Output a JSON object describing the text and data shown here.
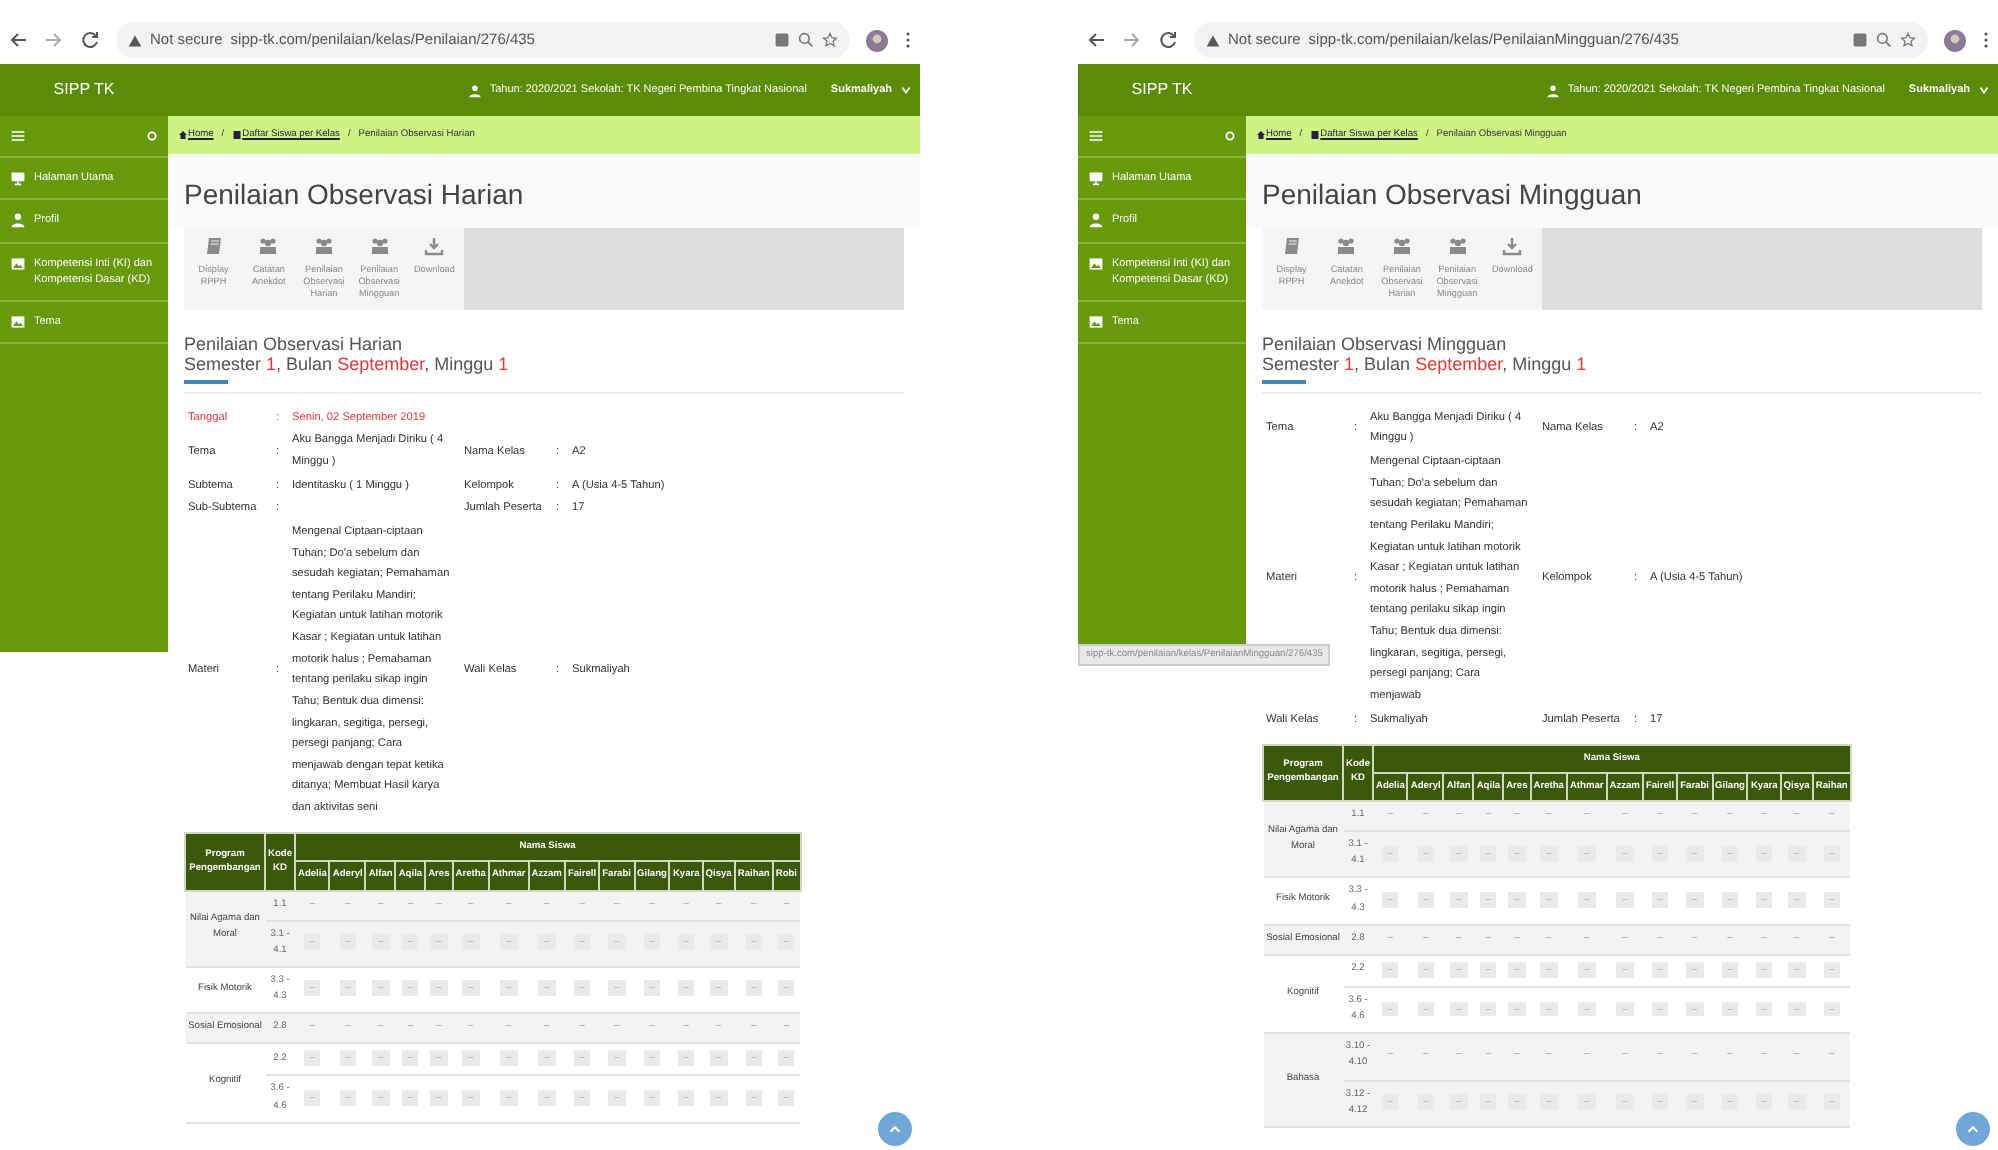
{
  "panes": [
    {
      "browser": {
        "security": "Not secure",
        "url": "sipp-tk.com/penilaian/kelas/Penilaian/276/435"
      },
      "header": {
        "brand": "SIPP TK",
        "info": "Tahun: 2020/2021 Sekolah: TK Negeri Pembina Tingkat Nasional",
        "user": "Sukmaliyah"
      },
      "sidebar": {
        "items": [
          {
            "label": "Halaman Utama"
          },
          {
            "label": "Profil"
          },
          {
            "label": "Kompetensi Inti (KI) dan Kompetensi Dasar (KD)"
          },
          {
            "label": "Tema"
          }
        ]
      },
      "breadcrumb": {
        "separator": "/",
        "items": [
          {
            "label": "Home",
            "link": true
          },
          {
            "label": "Daftar Siswa per Kelas",
            "link": true
          },
          {
            "label": "Penilaian Observasi Harian",
            "link": false
          }
        ]
      },
      "page_title": "Penilaian Observasi Harian",
      "toolbar": [
        "Display RPPH",
        "Catatan Anekdot",
        "Penilaian Observasi Harian",
        "Penilaian Observasi Mingguan",
        "Download"
      ],
      "section_title": "Penilaian Observasi Harian",
      "subtitle": [
        {
          "text": "Semester ",
          "highlight": false
        },
        {
          "text": "1",
          "highlight": true
        },
        {
          "text": ", Bulan ",
          "highlight": false
        },
        {
          "text": "September",
          "highlight": true
        },
        {
          "text": ", Minggu ",
          "highlight": false
        },
        {
          "text": "1",
          "highlight": true
        }
      ],
      "info_rows": [
        {
          "left": {
            "label": "Tanggal",
            "colon": ":",
            "value": "Senin, 02 September 2019",
            "highlight": true
          }
        },
        {
          "left": {
            "label": "Tema",
            "colon": ":",
            "value": "Aku Bangga Menjadi Diriku ( 4 Minggu )",
            "highlight": false
          },
          "right": {
            "label": "Nama Kelas",
            "colon": ":",
            "value": "A2"
          }
        },
        {
          "left": {
            "label": "Subtema",
            "colon": ":",
            "value": "Identitasku ( 1 Minggu )",
            "highlight": false
          },
          "right": {
            "label": "Kelompok",
            "colon": ":",
            "value": "A (Usia 4-5 Tahun)"
          }
        },
        {
          "left": {
            "label": "Sub-Subtema",
            "colon": ":",
            "highlight": false
          },
          "right": {
            "label": "Jumlah Peserta",
            "colon": ":",
            "value": "17"
          }
        },
        {
          "left": {
            "label": "Materi",
            "colon": ":",
            "value": "Mengenal Ciptaan-ciptaan Tuhan; Do'a sebelum dan sesudah kegiatan; Pemahaman tentang Perilaku Mandiri; Kegiatan untuk latihan motorik Kasar ; Kegiatan untuk latihan motorik halus ; Pemahaman tentang perilaku sikap ingin Tahu; Bentuk dua dimensi: lingkaran, segitiga, persegi, persegi panjang; Cara menjawab dengan tepat ketika ditanya; Membuat Hasil karya dan aktivitas seni",
            "highlight": false
          },
          "right": {
            "label": "Wali Kelas",
            "colon": ":",
            "value": "Sukmaliyah"
          }
        }
      ],
      "table": {
        "col_program": "Program Pengembangan",
        "col_kode": "Kode KD",
        "col_students": "Nama Siswa",
        "students": [
          "Adelia",
          "Aderyl",
          "Alfan",
          "Aqila",
          "Ares",
          "Aretha",
          "Athmar",
          "Azzam",
          "Fairell",
          "Farabi",
          "Gilang",
          "Kyara",
          "Qisya",
          "Raihan",
          "Robi"
        ],
        "groups": [
          {
            "program": "Nilai Agama dan Moral",
            "rows": [
              {
                "kode": "1.1",
                "kind": "text",
                "cells": [
                  "–",
                  "–",
                  "–",
                  "–",
                  "–",
                  "–",
                  "–",
                  "–",
                  "–",
                  "–",
                  "–",
                  "–",
                  "–",
                  "–",
                  "–"
                ]
              },
              {
                "kode": "3.1 - 4.1",
                "kind": "select",
                "cells": [
                  "–",
                  "–",
                  "–",
                  "–",
                  "–",
                  "–",
                  "–",
                  "–",
                  "–",
                  "–",
                  "–",
                  "–",
                  "–",
                  "–",
                  "–"
                ]
              }
            ]
          },
          {
            "program": "Fisik Motorik",
            "rows": [
              {
                "kode": "3.3 - 4.3",
                "kind": "select",
                "cells": [
                  "–",
                  "–",
                  "–",
                  "–",
                  "–",
                  "–",
                  "–",
                  "–",
                  "–",
                  "–",
                  "–",
                  "–",
                  "–",
                  "–",
                  "–"
                ]
              }
            ]
          },
          {
            "program": "Sosial Emosional",
            "rows": [
              {
                "kode": "2.8",
                "kind": "text",
                "cells": [
                  "–",
                  "–",
                  "–",
                  "–",
                  "–",
                  "–",
                  "–",
                  "–",
                  "–",
                  "–",
                  "–",
                  "–",
                  "–",
                  "–",
                  "–"
                ]
              }
            ]
          },
          {
            "program": "Kognitif",
            "rows": [
              {
                "kode": "2.2",
                "kind": "select",
                "cells": [
                  "–",
                  "–",
                  "–",
                  "–",
                  "–",
                  "–",
                  "–",
                  "–",
                  "–",
                  "–",
                  "–",
                  "–",
                  "–",
                  "–",
                  "–"
                ]
              },
              {
                "kode": "3.6 - 4.6",
                "kind": "select",
                "cells": [
                  "–",
                  "–",
                  "–",
                  "–",
                  "–",
                  "–",
                  "–",
                  "–",
                  "–",
                  "–",
                  "–",
                  "–",
                  "–",
                  "–",
                  "–"
                ]
              }
            ]
          }
        ]
      }
    },
    {
      "browser": {
        "security": "Not secure",
        "url": "sipp-tk.com/penilaian/kelas/PenilaianMingguan/276/435"
      },
      "header": {
        "brand": "SIPP TK",
        "info": "Tahun: 2020/2021 Sekolah: TK Negeri Pembina Tingkat Nasional",
        "user": "Sukmaliyah"
      },
      "sidebar": {
        "items": [
          {
            "label": "Halaman Utama"
          },
          {
            "label": "Profil"
          },
          {
            "label": "Kompetensi Inti (KI) dan Kompetensi Dasar (KD)"
          },
          {
            "label": "Tema"
          }
        ]
      },
      "breadcrumb": {
        "separator": "/",
        "items": [
          {
            "label": "Home",
            "link": true
          },
          {
            "label": "Daftar Siswa per Kelas",
            "link": true
          },
          {
            "label": "Penilaian Observasi Mingguan",
            "link": false
          }
        ]
      },
      "page_title": "Penilaian Observasi Mingguan",
      "toolbar": [
        "Display RPPH",
        "Catatan Anekdot",
        "Penilaian Observasi Harian",
        "Penilaian Observasi Mingguan",
        "Download"
      ],
      "section_title": "Penilaian Observasi Mingguan",
      "subtitle": [
        {
          "text": "Semester ",
          "highlight": false
        },
        {
          "text": "1",
          "highlight": true
        },
        {
          "text": ", Bulan ",
          "highlight": false
        },
        {
          "text": "September",
          "highlight": true
        },
        {
          "text": ", Minggu ",
          "highlight": false
        },
        {
          "text": "1",
          "highlight": true
        }
      ],
      "info_rows": [
        {
          "left": {
            "label": "Tema",
            "colon": ":",
            "value": "Aku Bangga Menjadi Diriku ( 4 Minggu )",
            "highlight": false
          },
          "right": {
            "label": "Nama Kelas",
            "colon": ":",
            "value": "A2"
          }
        },
        {
          "left": {
            "label": "Materi",
            "colon": ":",
            "value": "Mengenal Ciptaan-ciptaan Tuhan; Do'a sebelum dan sesudah kegiatan; Pemahaman tentang Perilaku Mandiri; Kegiatan untuk latihan motorik Kasar ; Kegiatan untuk latihan motorik halus ; Pemahaman tentang perilaku sikap ingin Tahu; Bentuk dua dimensi: lingkaran, segitiga, persegi, persegi panjang; Cara menjawab",
            "highlight": false
          },
          "right": {
            "label": "Kelompok",
            "colon": ":",
            "value": "A (Usia 4-5 Tahun)"
          }
        },
        {
          "left": {
            "label": "Wali Kelas",
            "colon": ":",
            "value": "Sukmaliyah",
            "highlight": false
          },
          "right": {
            "label": "Jumlah Peserta",
            "colon": ":",
            "value": "17"
          }
        }
      ],
      "status_url": "sipp-tk.com/penilaian/kelas/PenilaianMingguan/276/435",
      "table": {
        "col_program": "Program Pengembangan",
        "col_kode": "Kode KD",
        "col_students": "Nama Siswa",
        "students": [
          "Adelia",
          "Aderyl",
          "Alfan",
          "Aqila",
          "Ares",
          "Aretha",
          "Athmar",
          "Azzam",
          "Fairell",
          "Farabi",
          "Gilang",
          "Kyara",
          "Qisya",
          "Raihan"
        ],
        "groups": [
          {
            "program": "Nilai Agama dan Moral",
            "rows": [
              {
                "kode": "1.1",
                "kind": "text",
                "cells": [
                  "–",
                  "–",
                  "–",
                  "–",
                  "–",
                  "–",
                  "–",
                  "–",
                  "–",
                  "–",
                  "–",
                  "–",
                  "–",
                  "–"
                ]
              },
              {
                "kode": "3.1 - 4.1",
                "kind": "select",
                "cells": [
                  "–",
                  "–",
                  "–",
                  "–",
                  "–",
                  "–",
                  "–",
                  "–",
                  "–",
                  "–",
                  "–",
                  "–",
                  "–",
                  "–"
                ]
              }
            ]
          },
          {
            "program": "Fisik Motorik",
            "rows": [
              {
                "kode": "3.3 - 4.3",
                "kind": "select",
                "cells": [
                  "–",
                  "–",
                  "–",
                  "–",
                  "–",
                  "–",
                  "–",
                  "–",
                  "–",
                  "–",
                  "–",
                  "–",
                  "–",
                  "–"
                ]
              }
            ]
          },
          {
            "program": "Sosial Emosional",
            "rows": [
              {
                "kode": "2.8",
                "kind": "text",
                "cells": [
                  "–",
                  "–",
                  "–",
                  "–",
                  "–",
                  "–",
                  "–",
                  "–",
                  "–",
                  "–",
                  "–",
                  "–",
                  "–",
                  "–"
                ]
              }
            ]
          },
          {
            "program": "Kognitif",
            "rows": [
              {
                "kode": "2.2",
                "kind": "select",
                "cells": [
                  "–",
                  "–",
                  "–",
                  "–",
                  "–",
                  "–",
                  "–",
                  "–",
                  "–",
                  "–",
                  "–",
                  "–",
                  "–",
                  "–"
                ]
              },
              {
                "kode": "3.6 - 4.6",
                "kind": "select",
                "cells": [
                  "–",
                  "–",
                  "–",
                  "–",
                  "–",
                  "–",
                  "–",
                  "–",
                  "–",
                  "–",
                  "–",
                  "–",
                  "–",
                  "–"
                ]
              }
            ]
          },
          {
            "program": "Bahasa",
            "rows": [
              {
                "kode": "3.10 - 4.10",
                "kind": "text",
                "cells": [
                  "–",
                  "–",
                  "–",
                  "–",
                  "–",
                  "–",
                  "–",
                  "–",
                  "–",
                  "–",
                  "–",
                  "–",
                  "–",
                  "–"
                ]
              },
              {
                "kode": "3.12 - 4.12",
                "kind": "select",
                "cells": [
                  "–",
                  "–",
                  "–",
                  "–",
                  "–",
                  "–",
                  "–",
                  "–",
                  "–",
                  "–",
                  "–",
                  "–",
                  "–",
                  "–"
                ]
              }
            ]
          }
        ]
      }
    }
  ]
}
